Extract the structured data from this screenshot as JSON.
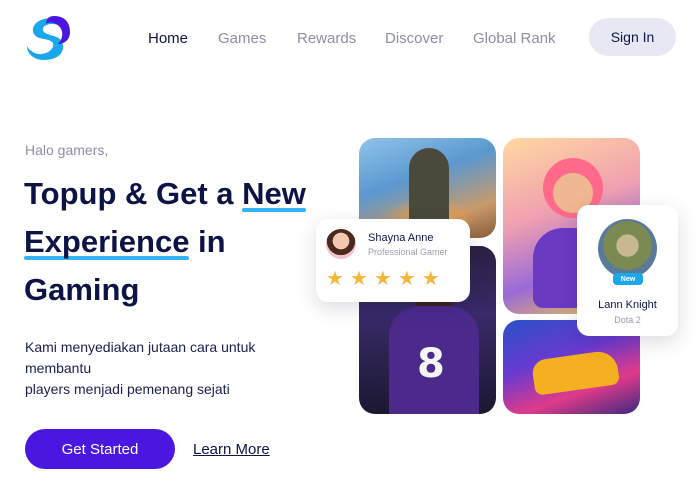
{
  "header": {
    "logo_icon": "s-logo-icon",
    "nav": [
      {
        "label": "Home",
        "active": true
      },
      {
        "label": "Games",
        "active": false
      },
      {
        "label": "Rewards",
        "active": false
      },
      {
        "label": "Discover",
        "active": false
      },
      {
        "label": "Global Rank",
        "active": false
      }
    ],
    "signin_label": "Sign In"
  },
  "hero": {
    "greeting": "Halo gamers,",
    "headline": {
      "part1": "Topup & Get a ",
      "highlight1": "New",
      "highlight2": "Experience",
      "part2": " in",
      "part3": "Gaming"
    },
    "description_lines": [
      "Kami menyediakan jutaan cara untuk",
      "membantu",
      "players menjadi pemenang sejati"
    ],
    "cta_label": "Get Started",
    "secondary_label": "Learn More"
  },
  "review_card": {
    "name": "Shayna Anne",
    "role": "Professional Gamer",
    "rating": 5,
    "stars": [
      "★",
      "★",
      "★",
      "★",
      "★"
    ]
  },
  "player_card": {
    "badge": "New",
    "name": "Lann Knight",
    "game": "Dota 2"
  },
  "colors": {
    "primary": "#4a17e0",
    "accent": "#34b4f5",
    "text": "#0d1445",
    "muted": "#8c8fa6",
    "star": "#f6b73c"
  }
}
